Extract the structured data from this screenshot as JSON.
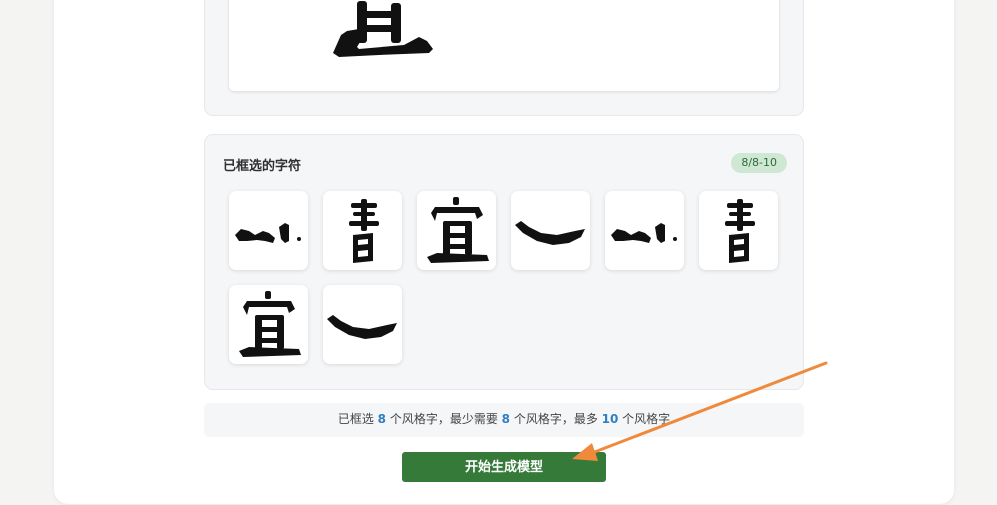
{
  "selected_panel": {
    "title": "已框选的字符",
    "badge": "8/8-10",
    "tiles": [
      {
        "glyph": "stroke-dot"
      },
      {
        "glyph": "shu"
      },
      {
        "glyph": "yi"
      },
      {
        "glyph": "curved-stroke"
      },
      {
        "glyph": "stroke-dot"
      },
      {
        "glyph": "shu"
      },
      {
        "glyph": "yi"
      },
      {
        "glyph": "curved-stroke"
      }
    ]
  },
  "info": {
    "t1": "已框选 ",
    "n1": "8",
    "t2": " 个风格字，最少需要 ",
    "n2": "8",
    "t3": " 个风格字，最多 ",
    "n3": "10",
    "t4": " 个风格字"
  },
  "start_button": {
    "label": "开始生成模型"
  },
  "colors": {
    "accent": "#367a3a",
    "badge_bg": "#cfe8d4",
    "number": "#2f7fc1",
    "arrow": "#ef8a3c"
  }
}
